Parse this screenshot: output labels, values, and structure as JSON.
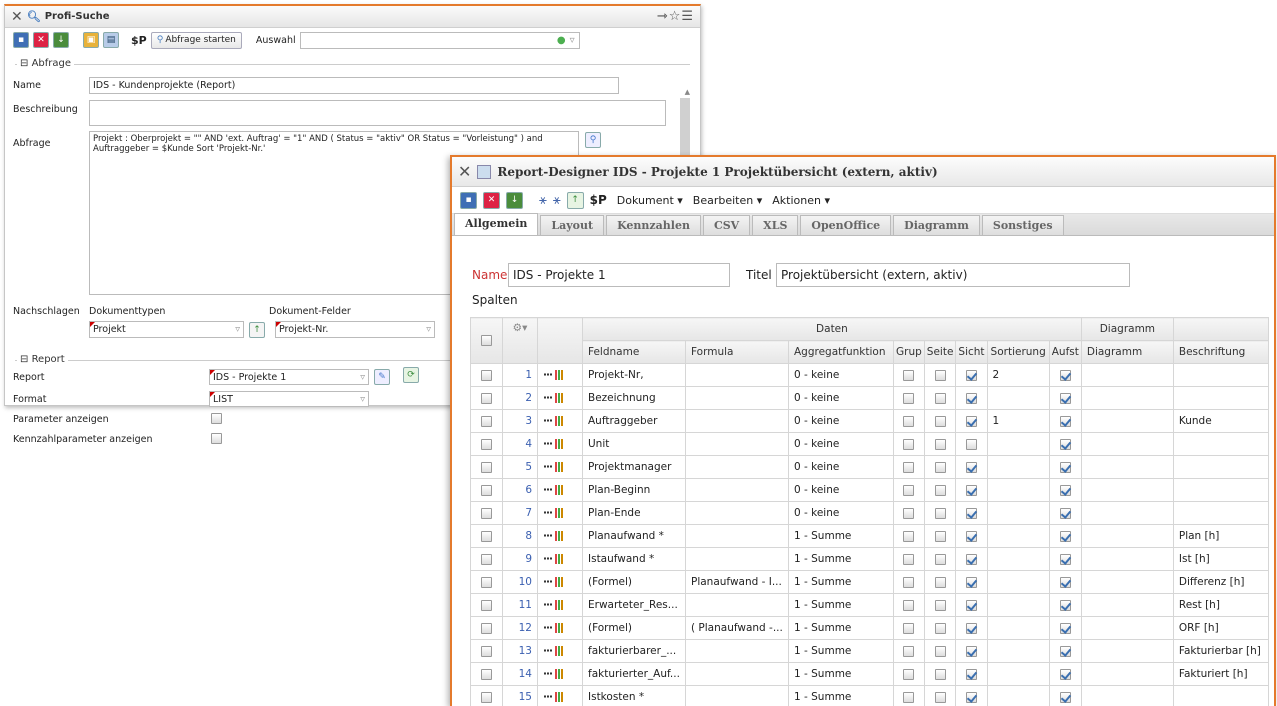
{
  "profi": {
    "title": "Profi-Suche",
    "toolbar": {
      "sp_label": "$P",
      "query_button": "Abfrage starten",
      "auswahl_label": "Auswahl"
    },
    "abfrage_section": "Abfrage",
    "name_label": "Name",
    "name_value": "IDS - Kundenprojekte (Report)",
    "beschreibung_label": "Beschreibung",
    "abfrage_label": "Abfrage",
    "abfrage_line1": "Projekt : Oberprojekt = \"\" AND 'ext. Auftrag' = \"1\" AND ( Status = \"aktiv\" OR Status = \"Vorleistung\" ) and",
    "abfrage_line2": "Auftraggeber = $Kunde Sort 'Projekt-Nr.'",
    "nachschlagen_label": "Nachschlagen",
    "dokumenttypen_label": "Dokumenttypen",
    "dokumentfelder_label": "Dokument-Felder",
    "dokumenttyp_value": "Projekt",
    "dokumentfeld_value": "Projekt-Nr.",
    "report_section": "Report",
    "report_label": "Report",
    "report_value": "IDS - Projekte 1",
    "format_label": "Format",
    "format_value": "LIST",
    "param_label": "Parameter anzeigen",
    "kennzahl_label": "Kennzahlparameter anzeigen"
  },
  "designer": {
    "title": "Report-Designer IDS - Projekte 1 Projektübersicht (extern, aktiv)",
    "toolbar": {
      "sp_label": "$P",
      "menu_dokument": "Dokument ▾",
      "menu_bearbeiten": "Bearbeiten ▾",
      "menu_aktionen": "Aktionen ▾"
    },
    "tabs": [
      "Allgemein",
      "Layout",
      "Kennzahlen",
      "CSV",
      "XLS",
      "OpenOffice",
      "Diagramm",
      "Sonstiges"
    ],
    "name_label": "Name",
    "name_value": "IDS - Projekte 1",
    "titel_label": "Titel",
    "titel_value": "Projektübersicht (extern, aktiv)",
    "spalten_label": "Spalten",
    "group_daten": "Daten",
    "group_diagramm": "Diagramm",
    "columns": [
      "Feldname",
      "Formula",
      "Aggregatfunktion",
      "Grup",
      "Seite",
      "Sicht",
      "Sortierung",
      "Aufst",
      "Diagramm",
      "Beschriftung"
    ],
    "rows": [
      {
        "n": "1",
        "feld": "Projekt-Nr,",
        "formula": "",
        "agg": "0 - keine",
        "sicht": true,
        "sort": "2",
        "label": ""
      },
      {
        "n": "2",
        "feld": "Bezeichnung",
        "formula": "",
        "agg": "0 - keine",
        "sicht": true,
        "sort": "",
        "label": ""
      },
      {
        "n": "3",
        "feld": "Auftraggeber",
        "formula": "",
        "agg": "0 - keine",
        "sicht": true,
        "sort": "1",
        "label": "Kunde"
      },
      {
        "n": "4",
        "feld": "Unit",
        "formula": "",
        "agg": "0 - keine",
        "sicht": false,
        "sort": "",
        "label": ""
      },
      {
        "n": "5",
        "feld": "Projektmanager",
        "formula": "",
        "agg": "0 - keine",
        "sicht": true,
        "sort": "",
        "label": ""
      },
      {
        "n": "6",
        "feld": "Plan-Beginn",
        "formula": "",
        "agg": "0 - keine",
        "sicht": true,
        "sort": "",
        "label": ""
      },
      {
        "n": "7",
        "feld": "Plan-Ende",
        "formula": "",
        "agg": "0 - keine",
        "sicht": true,
        "sort": "",
        "label": ""
      },
      {
        "n": "8",
        "feld": "Planaufwand *",
        "formula": "",
        "agg": "1 - Summe",
        "sicht": true,
        "sort": "",
        "label": "Plan [h]"
      },
      {
        "n": "9",
        "feld": "Istaufwand *",
        "formula": "",
        "agg": "1 - Summe",
        "sicht": true,
        "sort": "",
        "label": "Ist [h]"
      },
      {
        "n": "10",
        "feld": "(Formel)",
        "formula": "Planaufwand - I...",
        "agg": "1 - Summe",
        "sicht": true,
        "sort": "",
        "label": "Differenz [h]"
      },
      {
        "n": "11",
        "feld": "Erwarteter_Res...",
        "formula": "",
        "agg": "1 - Summe",
        "sicht": true,
        "sort": "",
        "label": "Rest [h]"
      },
      {
        "n": "12",
        "feld": "(Formel)",
        "formula": "( Planaufwand -...",
        "agg": "1 - Summe",
        "sicht": true,
        "sort": "",
        "label": "ORF [h]"
      },
      {
        "n": "13",
        "feld": "fakturierbarer_...",
        "formula": "",
        "agg": "1 - Summe",
        "sicht": true,
        "sort": "",
        "label": "Fakturierbar [h]"
      },
      {
        "n": "14",
        "feld": "fakturierter_Auf...",
        "formula": "",
        "agg": "1 - Summe",
        "sicht": true,
        "sort": "",
        "label": "Fakturiert [h]"
      },
      {
        "n": "15",
        "feld": "Istkosten *",
        "formula": "",
        "agg": "1 - Summe",
        "sicht": true,
        "sort": "",
        "label": ""
      }
    ]
  }
}
